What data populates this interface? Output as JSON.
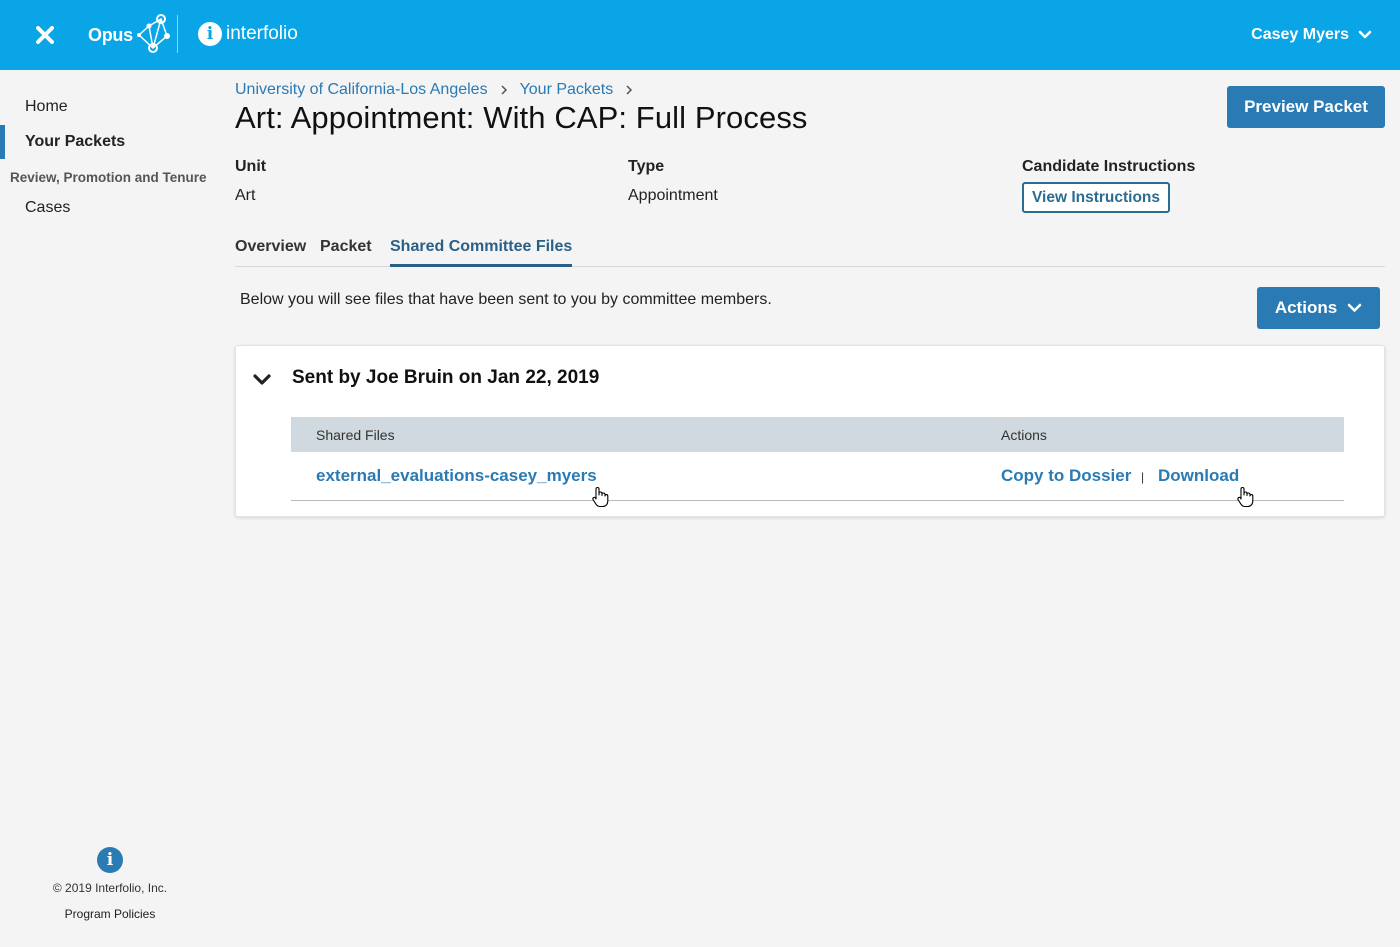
{
  "header": {
    "app_name": "Opus",
    "partner_name": "interfolio",
    "user_name": "Casey Myers",
    "accent_color": "#0aa5e6"
  },
  "sidebar": {
    "items": [
      {
        "label": "Home"
      },
      {
        "label": "Your Packets"
      }
    ],
    "section_title": "Review, Promotion and Tenure",
    "section_items": [
      {
        "label": "Cases"
      }
    ],
    "footer": {
      "copyright": "© 2019 Interfolio, Inc.",
      "policies_link": "Program Policies",
      "icon": "info-icon"
    }
  },
  "breadcrumb": {
    "items": [
      {
        "label": "University of California-Los Angeles"
      },
      {
        "label": "Your Packets"
      }
    ]
  },
  "page": {
    "title": "Art: Appointment: With CAP: Full Process",
    "preview_button": "Preview Packet",
    "meta": {
      "unit_label": "Unit",
      "unit_value": "Art",
      "type_label": "Type",
      "type_value": "Appointment",
      "instructions_label": "Candidate Instructions",
      "instructions_button": "View Instructions"
    },
    "tabs": [
      {
        "label": "Overview",
        "active": false
      },
      {
        "label": "Packet",
        "active": false
      },
      {
        "label": "Shared Committee Files",
        "active": true
      }
    ],
    "intro_text": "Below you will see files that have been sent to you by committee members.",
    "actions_button": "Actions"
  },
  "shared_files": {
    "group_title": "Sent by Joe Bruin on Jan 22, 2019",
    "columns": [
      "Shared Files",
      "Actions"
    ],
    "rows": [
      {
        "file_name": "external_evaluations-casey_myers",
        "action_copy": "Copy to Dossier",
        "action_separator": "|",
        "action_download": "Download"
      }
    ]
  },
  "colors": {
    "primary_button": "#2a7ab4",
    "link": "#2a7ab4",
    "table_header": "#cfd9df",
    "active_tab": "#2a5f86"
  }
}
